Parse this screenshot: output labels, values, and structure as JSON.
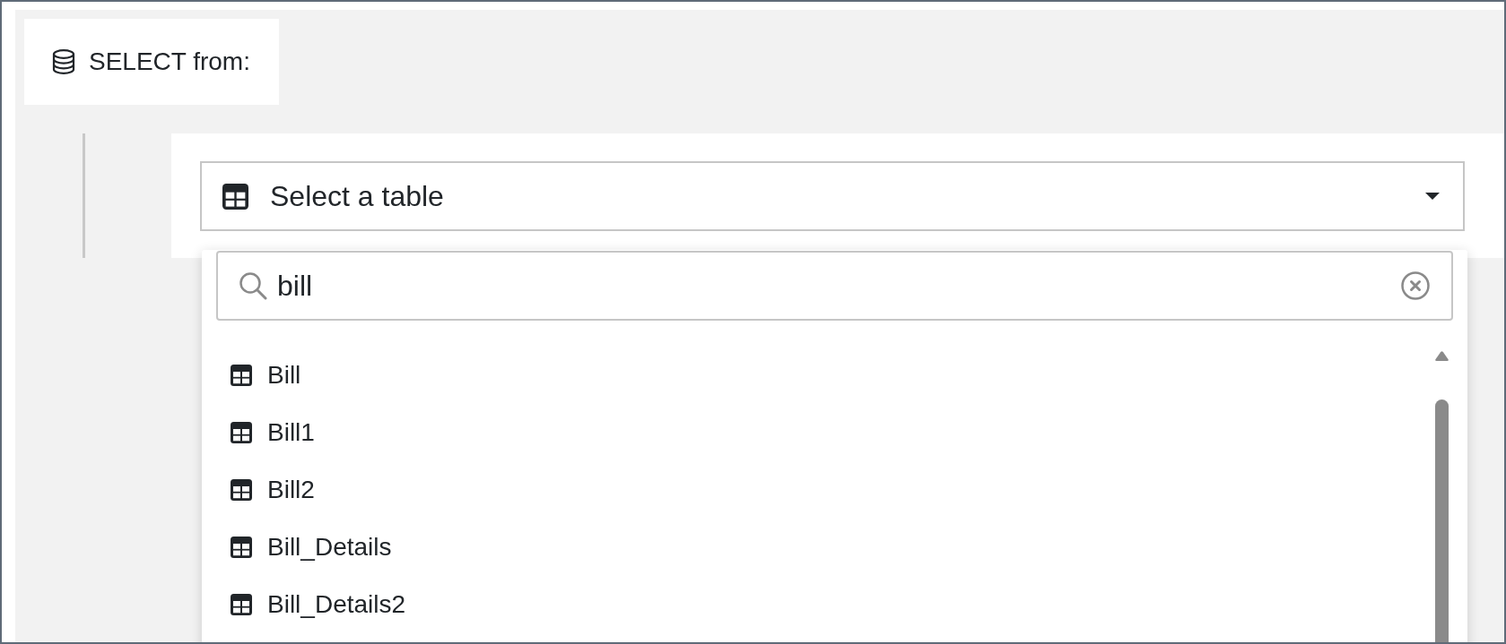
{
  "query_block": {
    "label": "SELECT from:"
  },
  "table_select": {
    "placeholder": "Select a table",
    "expanded": true
  },
  "dropdown": {
    "search": {
      "value": "bill"
    },
    "options": [
      {
        "label": "Bill",
        "selected": false
      },
      {
        "label": "Bill1",
        "selected": false
      },
      {
        "label": "Bill2",
        "selected": false
      },
      {
        "label": "Bill_Details",
        "selected": false
      },
      {
        "label": "Bill_Details2",
        "selected": false
      }
    ]
  }
}
